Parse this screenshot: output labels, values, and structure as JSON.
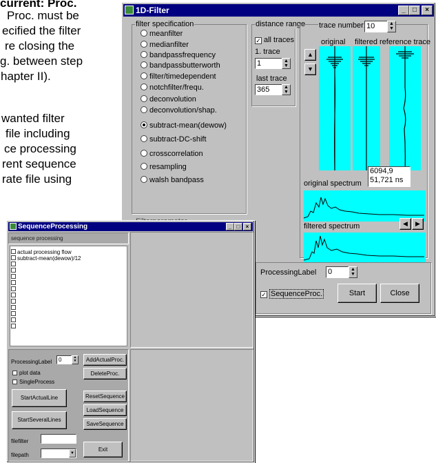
{
  "doc": {
    "lines": [
      "current: Proc.",
      "Proc. must be",
      "ecified the filter",
      "re closing the",
      "g. between step",
      "hapter II).",
      "wanted filter",
      "file including",
      "ce processing",
      "rent sequence",
      "rate file using"
    ]
  },
  "filter_window": {
    "title": "1D-Filter",
    "buttons": {
      "minimize": "_",
      "maximize": "□",
      "close": "×"
    },
    "filter_spec_title": "filter specification",
    "filters": [
      "meanfilter",
      "medianfilter",
      "bandpassfrequency",
      "bandpassbutterworth",
      "filter/timedependent",
      "notchfilter/frequ.",
      "deconvolution",
      "deconvolution/shap.",
      "subtract-mean(dewow)",
      "subtract-DC-shift",
      "crosscorrelation",
      "resampling",
      "walsh bandpass"
    ],
    "selected_filter": "subtract-mean(dewow)",
    "filter_params_label": "Filterparameter",
    "distance_range_title": "distance range",
    "all_traces_label": "all traces",
    "all_traces_checked": true,
    "first_trace_label": "1. trace",
    "first_trace_value": "1",
    "last_trace_label": "last trace",
    "last_trace_value": "365",
    "trace_number_label": "trace number:",
    "trace_number_value": "10",
    "col_original": "original",
    "col_filtered": "filtered",
    "col_reference": "reference trace",
    "readout_line1": "6094,9",
    "readout_line2": "51,721 ns",
    "original_spectrum_label": "original spectrum",
    "filtered_spectrum_label": "filtered spectrum",
    "processing_label": "ProcessingLabel",
    "processing_value": "0",
    "sequence_proc_label": "SequenceProc.",
    "sequence_proc_checked": true,
    "start_label": "Start",
    "close_label": "Close",
    "trace_color": "#00ffff"
  },
  "seq_window": {
    "title": "SequenceProcessing",
    "buttons": {
      "minimize": "_",
      "maximize": "□",
      "close": "×"
    },
    "group_title": "sequence processing",
    "items": [
      "actual processing flow",
      "subtract-mean(dewow)/12",
      "",
      "",
      "",
      "",
      "",
      "",
      "",
      "",
      "",
      "",
      ""
    ],
    "processing_label": "ProcessingLabel",
    "processing_value": "0",
    "add_actual_proc": "AddActualProc.",
    "delete_proc": "DeleteProc.",
    "plot_data": "plot data",
    "single_process": "SingleProcess",
    "start_actual_line": "StartActualLine",
    "start_several_lines": "StartSeveralLines",
    "reset_sequence": "ResetSequence",
    "load_sequence": "LoadSequence",
    "save_sequence": "SaveSequence",
    "filefilter_label": "filefilter",
    "filepath_label": "filepath",
    "exit_label": "Exit"
  }
}
